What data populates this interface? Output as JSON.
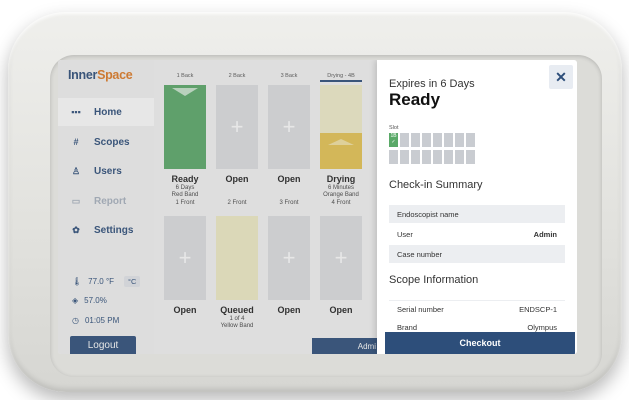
{
  "logo": {
    "part1": "Inner",
    "part2": "Space"
  },
  "nav": [
    {
      "label": "Home",
      "icon": "grid-icon"
    },
    {
      "label": "Scopes",
      "icon": "hash-icon"
    },
    {
      "label": "Users",
      "icon": "user-icon"
    },
    {
      "label": "Report",
      "icon": "report-icon"
    },
    {
      "label": "Settings",
      "icon": "gear-icon"
    }
  ],
  "env": {
    "temp": "77.0 °F",
    "temp_alt_unit": "°C",
    "humidity": "57.0%",
    "time": "01:05 PM"
  },
  "logout_label": "Logout",
  "columns_top": [
    "1 Back",
    "2 Back",
    "3 Back",
    "Drying - 4B"
  ],
  "slots_top": [
    {
      "status": "Ready",
      "sub1": "6 Days",
      "sub2": "Red Band",
      "sub3": "1 Front"
    },
    {
      "status": "Open",
      "sub1": "",
      "sub2": "",
      "sub3": "2 Front"
    },
    {
      "status": "Open",
      "sub1": "",
      "sub2": "",
      "sub3": "3 Front"
    },
    {
      "status": "Drying",
      "sub1": "6 Minutes",
      "sub2": "Orange Band",
      "sub3": "4 Front"
    }
  ],
  "slots_bottom": [
    {
      "status": "Open",
      "sub1": "",
      "sub2": ""
    },
    {
      "status": "Queued",
      "sub1": "1 of 4",
      "sub2": "Yellow Band"
    },
    {
      "status": "Open",
      "sub1": "",
      "sub2": ""
    },
    {
      "status": "Open",
      "sub1": "",
      "sub2": ""
    }
  ],
  "admin_bar": "Admi",
  "panel": {
    "close": "✕",
    "expires": "Expires in 6 Days",
    "status": "Ready",
    "slot_label": "Slot",
    "selected_slot": "1B",
    "checkin_title": "Check-in Summary",
    "endoscopist_label": "Endoscopist name",
    "user_label": "User",
    "user_value": "Admin",
    "case_label": "Case number",
    "scope_title": "Scope Information",
    "serial_label": "Serial number",
    "serial_value": "ENDSCP-1",
    "brand_label": "Brand",
    "brand_value": "Olympus",
    "checkout_label": "Checkout"
  },
  "colors": {
    "brand_blue": "#2d4e7a",
    "brand_orange": "#e07b24",
    "ready_green": "#5aa968",
    "drying_orange": "#e7c552"
  }
}
